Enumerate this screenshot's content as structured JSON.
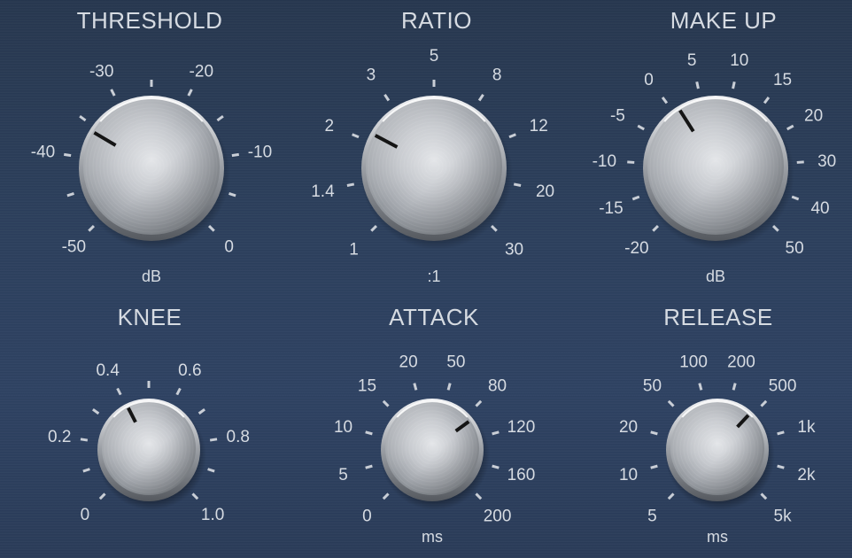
{
  "knobs": [
    {
      "id": "threshold",
      "title": "THRESHOLD",
      "unit": "dB",
      "labels": [
        "-50",
        "-40",
        "-30",
        "-20",
        "-10",
        "0"
      ],
      "value_label": "-35",
      "pointer_fraction": 0.28
    },
    {
      "id": "ratio",
      "title": "RATIO",
      "unit": ":1",
      "labels": [
        "1",
        "1.4",
        "2",
        "3",
        "5",
        "8",
        "12",
        "20",
        "30"
      ],
      "value_label": "2",
      "pointer_fraction": 0.27
    },
    {
      "id": "makeup",
      "title": "MAKE UP",
      "unit": "dB",
      "labels": [
        "-20",
        "-15",
        "-10",
        "-5",
        "0",
        "5",
        "10",
        "15",
        "20",
        "30",
        "40",
        "50"
      ],
      "value_label": "0",
      "pointer_fraction": 0.38
    },
    {
      "id": "knee",
      "title": "KNEE",
      "unit": "",
      "labels": [
        "0",
        "0.2",
        "0.4",
        "0.6",
        "0.8",
        "1.0"
      ],
      "value_label": "0.4",
      "pointer_fraction": 0.4
    },
    {
      "id": "attack",
      "title": "ATTACK",
      "unit": "ms",
      "labels": [
        "0",
        "5",
        "10",
        "15",
        "20",
        "50",
        "80",
        "120",
        "160",
        "200"
      ],
      "value_label": "120",
      "pointer_fraction": 0.7
    },
    {
      "id": "release",
      "title": "RELEASE",
      "unit": "ms",
      "labels": [
        "5",
        "10",
        "20",
        "50",
        "100",
        "200",
        "500",
        "1k",
        "2k",
        "5k"
      ],
      "value_label": "500",
      "pointer_fraction": 0.66
    }
  ]
}
